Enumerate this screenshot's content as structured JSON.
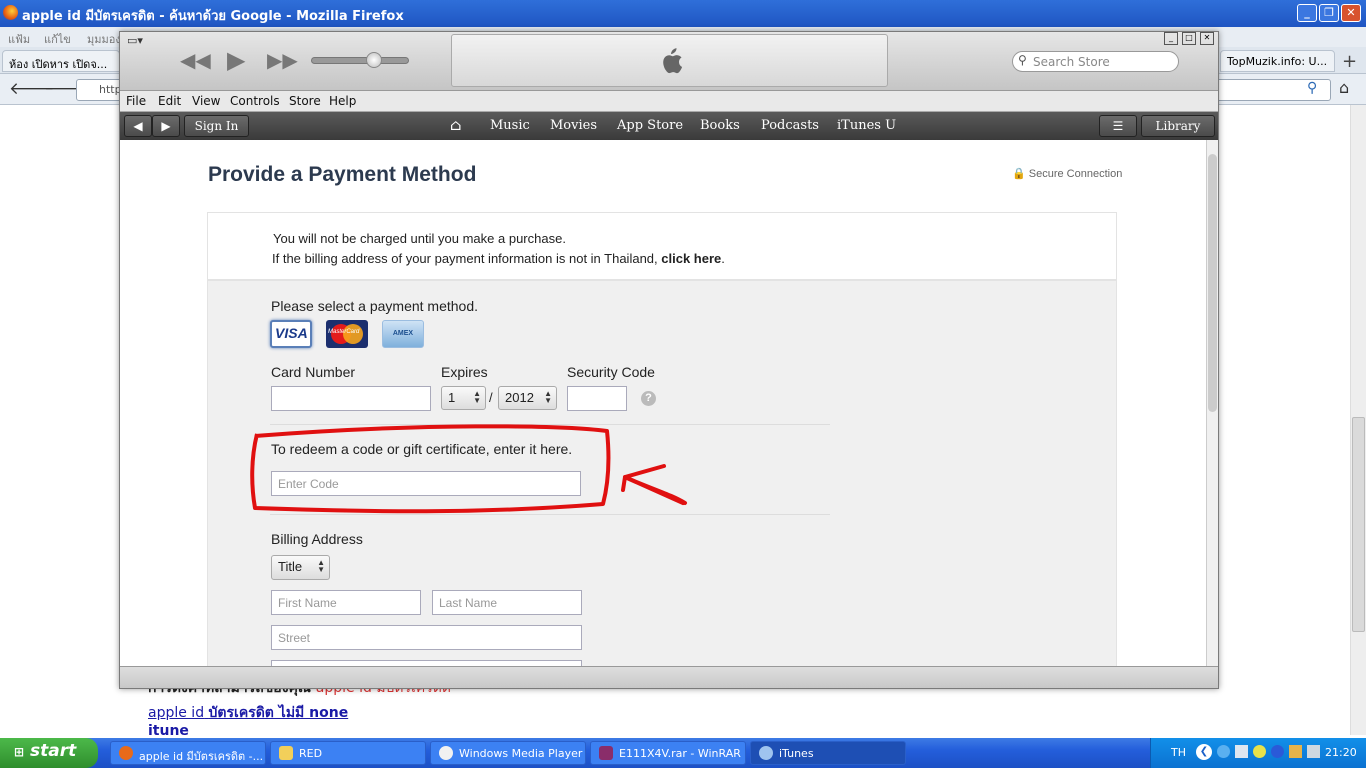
{
  "firefox": {
    "title": "apple id มีบัตรเครดิต - ค้นหาด้วย Google - Mozilla Firefox",
    "menu": [
      "แฟ้ม",
      "แก้ไข",
      "มุมมอง"
    ],
    "tabs": [
      "ห้อง เปิดหาร เปิดจ...",
      "TopMuzik.info: U..."
    ],
    "url": "http",
    "page_lines": [
      {
        "a": "การตั้งค่าที่สามารถของคุณ",
        "b": "apple id มีบัตรเครดิต"
      },
      {
        "a": "apple id",
        "b": "บัตรเครดิต ไม่มี none"
      },
      {
        "a": "itune",
        "b": ""
      }
    ]
  },
  "itunes": {
    "search_placeholder": "Search Store",
    "menu": [
      "File",
      "Edit",
      "View",
      "Controls",
      "Store",
      "Help"
    ],
    "nav": {
      "sign_in": "Sign In",
      "items": [
        "Music",
        "Movies",
        "App Store",
        "Books",
        "Podcasts",
        "iTunes U"
      ],
      "library": "Library"
    }
  },
  "page": {
    "title": "Provide a Payment Method",
    "secure": "Secure Connection",
    "notice_line1": "You will not be charged until you make a purchase.",
    "notice_line2": "If the billing address of your payment information is not in Thailand, ",
    "notice_link": "click here",
    "notice_end": ".",
    "select_method": "Please select a payment method.",
    "cards": [
      "VISA",
      "MasterCard",
      "AMEX"
    ],
    "card_number_label": "Card Number",
    "expires_label": "Expires",
    "expires_month": "1",
    "expires_sep": "/",
    "expires_year": "2012",
    "security_label": "Security Code",
    "help_icon": "?",
    "redeem_text": "To redeem a code or gift certificate, enter it here.",
    "redeem_placeholder": "Enter Code",
    "billing_label": "Billing Address",
    "title_select": "Title",
    "first_name_placeholder": "First Name",
    "last_name_placeholder": "Last Name",
    "street_placeholder": "Street"
  },
  "taskbar": {
    "start": "start",
    "tasks": [
      "apple id มีบัตรเครดิต -...",
      "RED",
      "Windows Media Player",
      "E111X4V.rar - WinRAR",
      "iTunes"
    ],
    "lang": "TH",
    "clock": "21:20"
  },
  "colors": {
    "annotation": "#e01010",
    "xp_blue": "#245edb",
    "start_green": "#3a9d38"
  }
}
